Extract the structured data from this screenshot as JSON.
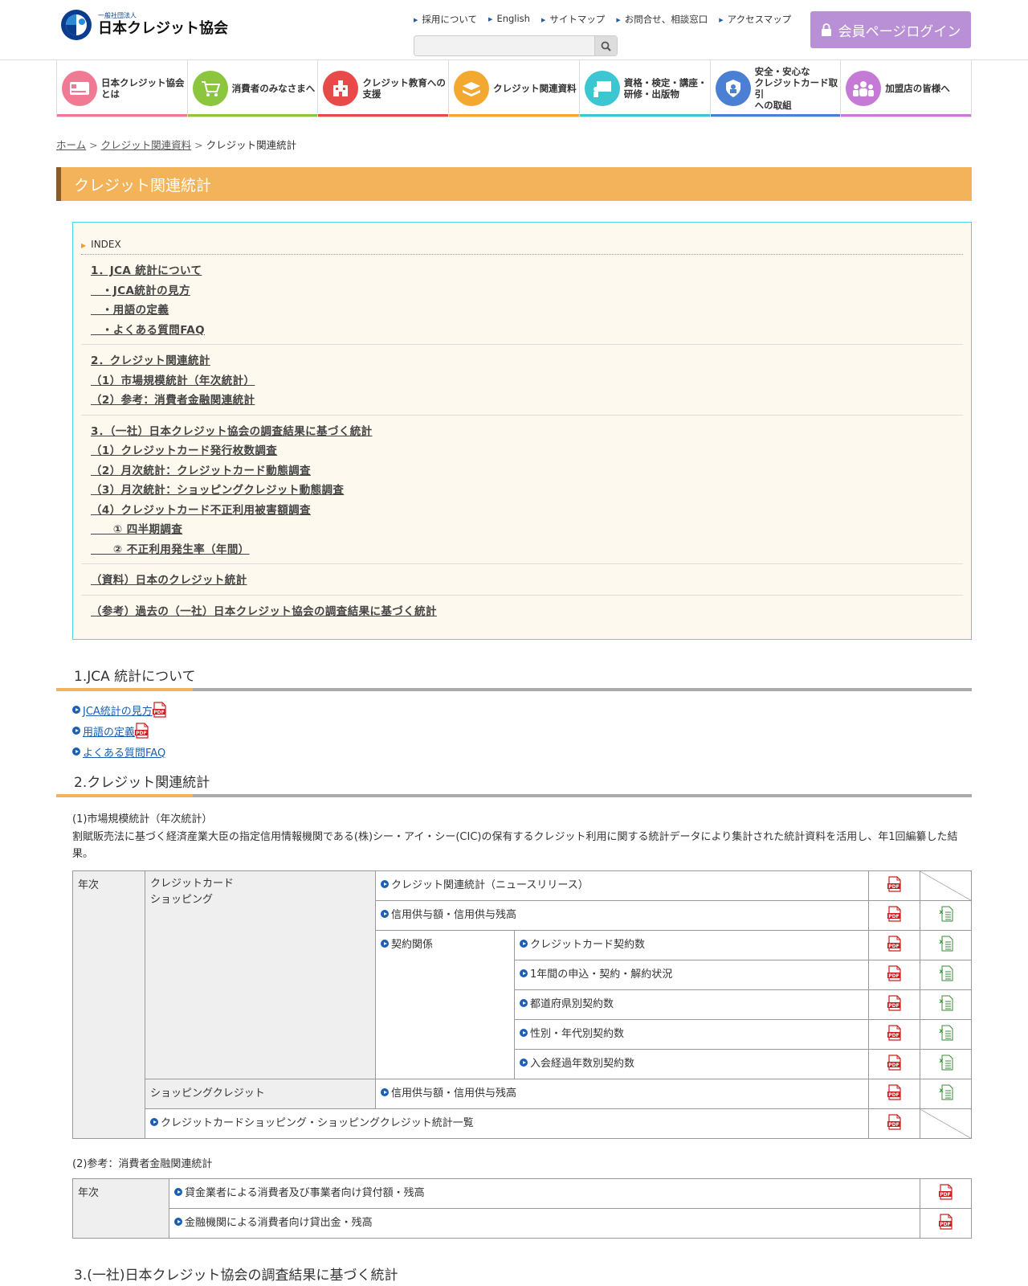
{
  "header": {
    "logo_small": "一般社団法人",
    "logo_name": "日本クレジット協会",
    "util_links": [
      "採用について",
      "English",
      "サイトマップ",
      "お問合せ、相談窓口",
      "アクセスマップ"
    ],
    "search_placeholder": "",
    "login_label": "会員ページログイン"
  },
  "gnav": [
    {
      "line1": "日本クレジット協会",
      "line2": "とは",
      "line3": "",
      "color": "#f07a94"
    },
    {
      "line1": "消費者のみなさまへ",
      "line2": "",
      "line3": "",
      "color": "#8cc63f"
    },
    {
      "line1": "クレジット教育への",
      "line2": "支援",
      "line3": "",
      "color": "#e84a4a"
    },
    {
      "line1": "クレジット関連資料",
      "line2": "",
      "line3": "",
      "color": "#f3a930"
    },
    {
      "line1": "資格・検定・講座・",
      "line2": "研修・出版物",
      "line3": "",
      "color": "#3cc6d2"
    },
    {
      "line1": "安全・安心な",
      "line2": "クレジットカード取引",
      "line3": "への取組",
      "color": "#4a7fd4"
    },
    {
      "line1": "加盟店の皆様へ",
      "line2": "",
      "line3": "",
      "color": "#c57ad6"
    }
  ],
  "breadcrumb": {
    "home": "ホーム",
    "parent": "クレジット関連資料",
    "current": "クレジット関連統計"
  },
  "page_title": "クレジット関連統計",
  "index": {
    "heading": "INDEX",
    "groups": [
      [
        "1．JCA 統計について",
        "　・JCA統計の見方",
        "　・用語の定義",
        "　・よくある質問FAQ"
      ],
      [
        "2．クレジット関連統計",
        "（1）市場規模統計（年次統計）",
        "（2）参考：消費者金融関連統計"
      ],
      [
        "3．（一社）日本クレジット協会の調査結果に基づく統計",
        "（1）クレジットカード発行枚数調査",
        "（2）月次統計：クレジットカード動態調査",
        "（3）月次統計：ショッピングクレジット動態調査",
        "（4）クレジットカード不正利用被害額調査",
        "　　① 四半期調査",
        "　　② 不正利用発生率（年間）"
      ],
      [
        "（資料）日本のクレジット統計"
      ],
      [
        "（参考）過去の（一社）日本クレジット協会の調査結果に基づく統計"
      ]
    ]
  },
  "section1": {
    "title": "1.JCA 統計について",
    "links": [
      "JCA統計の見方",
      "用語の定義",
      "よくある質問FAQ"
    ]
  },
  "section2": {
    "title": "2.クレジット関連統計",
    "sub1": "(1)市場規模統計（年次統計）",
    "desc": "割賦販売法に基づく経済産業大臣の指定信用情報機関である(株)シー・アイ・シー(CIC)の保有するクレジット利用に関する統計データにより集計された統計資料を活用し、年1回編纂した結果。",
    "table1": {
      "annual": "年次",
      "cat_card_1": "クレジットカード",
      "cat_card_2": "ショッピング",
      "r1": "クレジット関連統計（ニュースリリース）",
      "r2": "信用供与額・信用供与残高",
      "contract": "契約関係",
      "c1": "クレジットカード契約数",
      "c2": "1年間の申込・契約・解約状況",
      "c3": "都道府県別契約数",
      "c4": "性別・年代別契約数",
      "c5": "入会経過年数別契約数",
      "cat_shop": "ショッピングクレジット",
      "r_shop": "信用供与額・信用供与残高",
      "r_all": "クレジットカードショッピング・ショッピングクレジット統計一覧"
    },
    "sub2": "(2)参考：消費者金融関連統計",
    "table2": {
      "annual": "年次",
      "r1": "貸金業者による消費者及び事業者向け貸付額・残高",
      "r2": "金融機関による消費者向け貸出金・残高"
    }
  },
  "section3": {
    "title": "3.(一社)日本クレジット協会の調査結果に基づく統計"
  },
  "icons": {
    "pdf": "pdf-icon",
    "xls": "excel-icon",
    "search": "search-icon",
    "lock": "lock-icon"
  }
}
